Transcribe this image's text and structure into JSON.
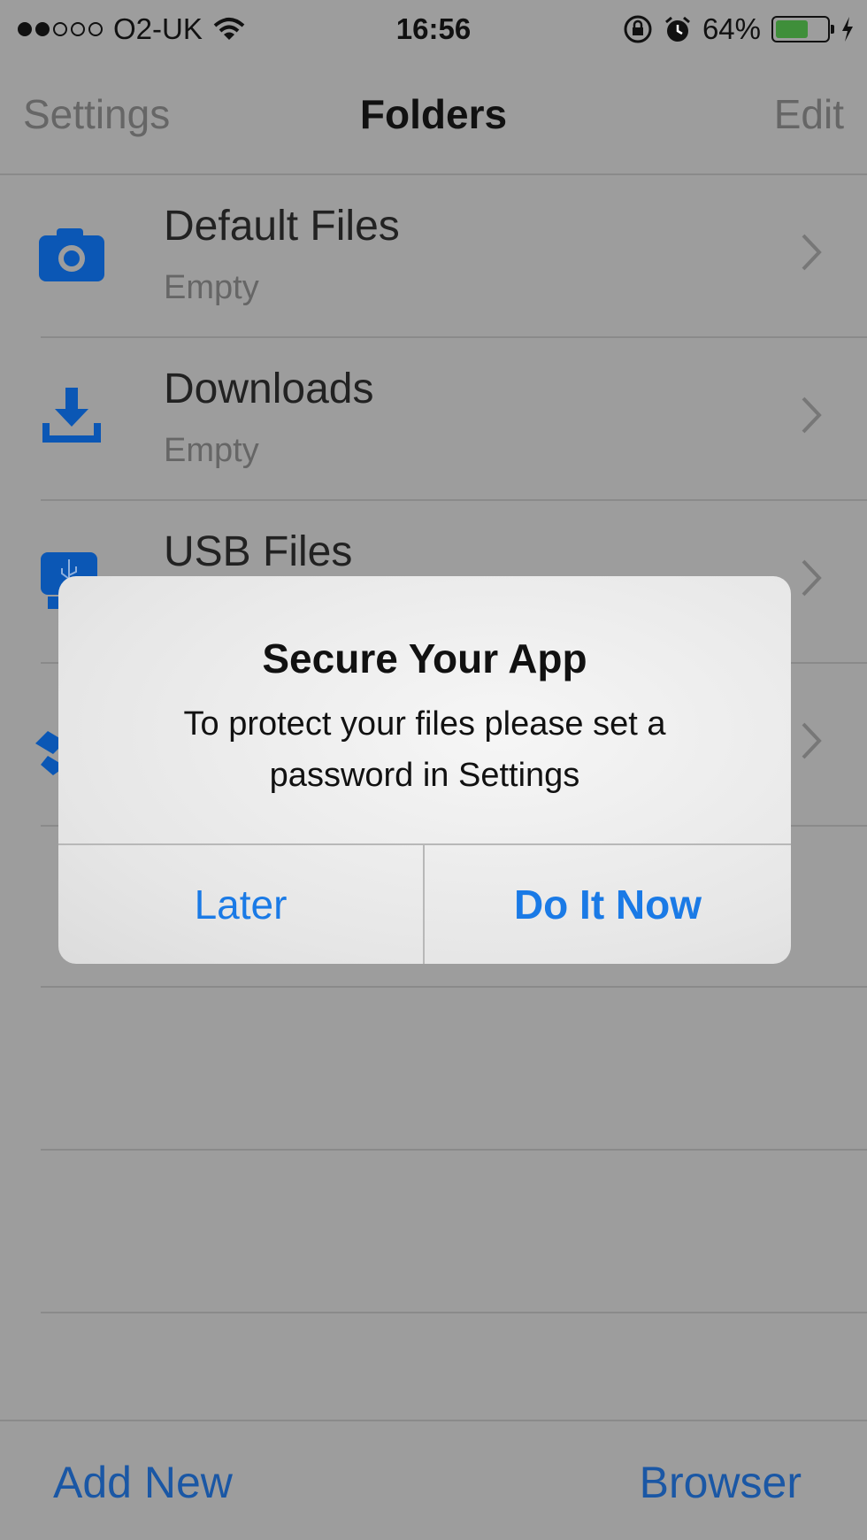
{
  "status_bar": {
    "carrier": "O2-UK",
    "time": "16:56",
    "battery_percent": "64%",
    "battery_level": 0.64,
    "icons": [
      "signal-dots-icon",
      "wifi-icon",
      "rotation-lock-icon",
      "alarm-icon",
      "battery-icon",
      "charging-icon"
    ]
  },
  "nav": {
    "left": "Settings",
    "title": "Folders",
    "right": "Edit"
  },
  "folders": [
    {
      "name": "Default Files",
      "subtitle": "Empty",
      "icon": "camera-icon"
    },
    {
      "name": "Downloads",
      "subtitle": "Empty",
      "icon": "download-icon"
    },
    {
      "name": "USB Files",
      "subtitle": "",
      "icon": "usb-icon"
    },
    {
      "name": "",
      "subtitle": "",
      "icon": "dropbox-icon"
    }
  ],
  "toolbar": {
    "left": "Add New",
    "right": "Browser"
  },
  "alert": {
    "title": "Secure Your App",
    "message": "To protect your files please set a password in Settings",
    "cancel": "Later",
    "confirm": "Do It Now"
  },
  "colors": {
    "accent_blue": "#1a7ae6",
    "toolbar_blue": "#1a57a5",
    "icon_blue": "#0b57b5",
    "overlay_gray": "#9d9d9d"
  }
}
